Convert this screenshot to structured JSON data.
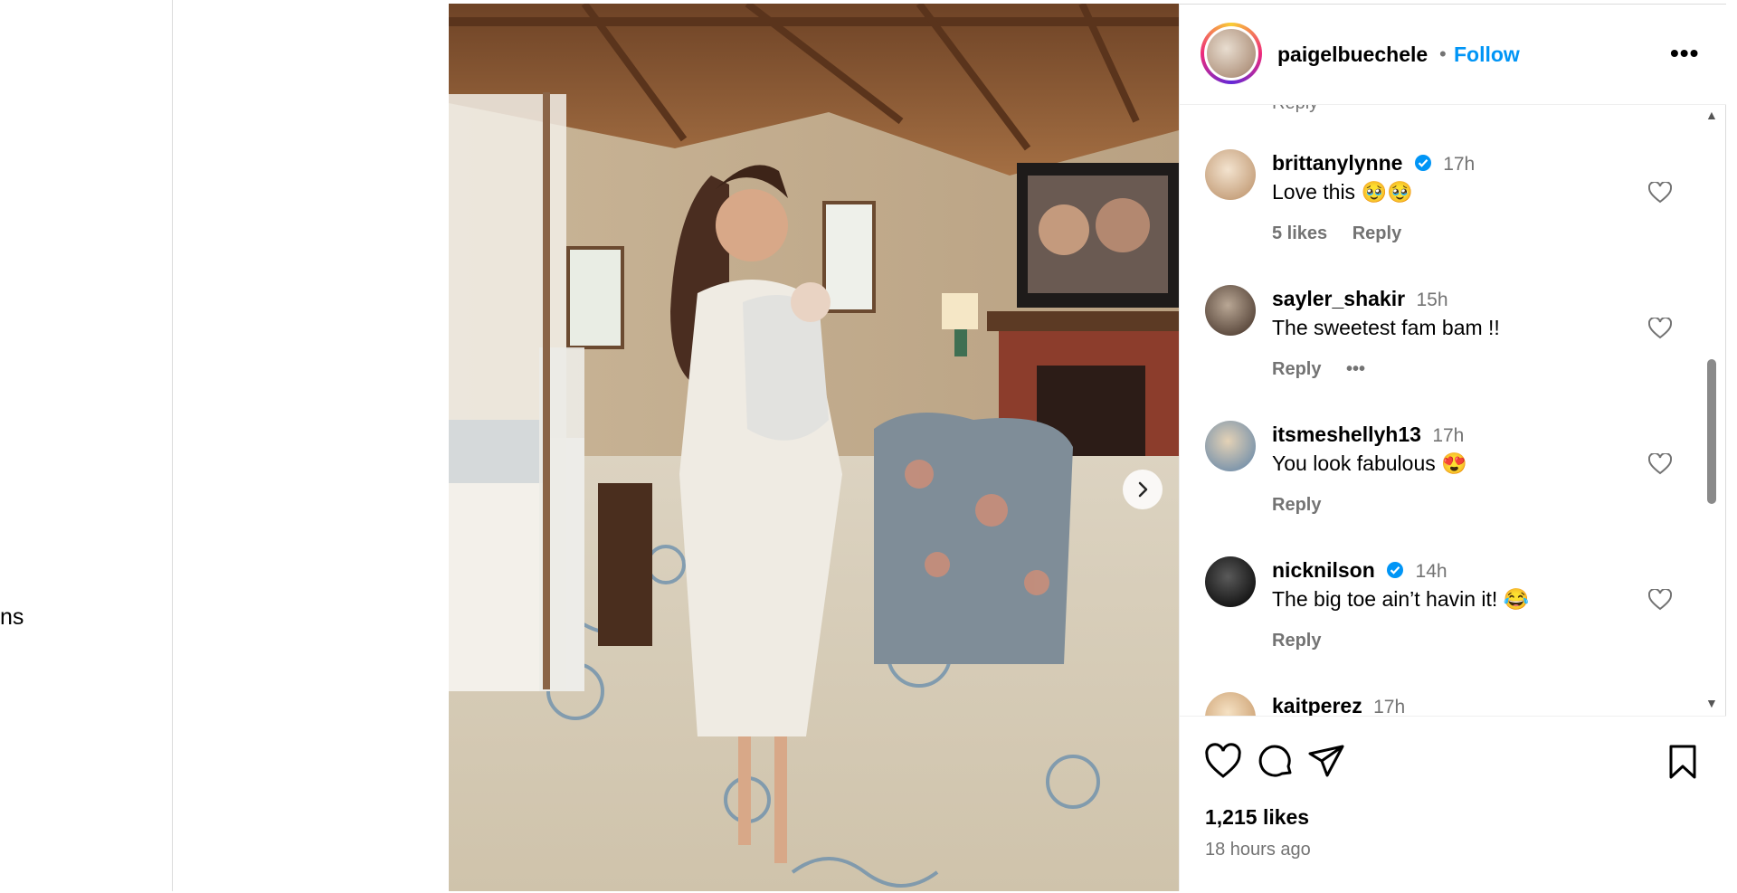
{
  "sidebar": {
    "fragment_text": "ns"
  },
  "post": {
    "author": "paigelbuechele",
    "follow_label": "Follow",
    "separator": "•",
    "more_label": "•••",
    "partial_reply": "Reply",
    "comments": [
      {
        "user": "brittanylynne",
        "verified": true,
        "time": "17h",
        "text": "Love this 🥹🥹",
        "likes": "5 likes",
        "reply": "Reply",
        "more": "",
        "avatar_color": "#d9c2a6"
      },
      {
        "user": "sayler_shakir",
        "verified": false,
        "time": "15h",
        "text": "The sweetest fam bam !!",
        "likes": "",
        "reply": "Reply",
        "more": "•••",
        "avatar_color": "#7a6a5c"
      },
      {
        "user": "itsmeshellyh13",
        "verified": false,
        "time": "17h",
        "text": "You look fabulous 😍",
        "likes": "",
        "reply": "Reply",
        "more": "",
        "avatar_color": "#9fb3c7"
      },
      {
        "user": "nicknilson",
        "verified": true,
        "time": "14h",
        "text": "The big toe ain’t havin it! 😂",
        "likes": "",
        "reply": "Reply",
        "more": "",
        "avatar_color": "#2a2a2a"
      },
      {
        "user": "kaitperez",
        "verified": false,
        "time": "17h",
        "text": "",
        "likes": "",
        "reply": "",
        "more": "",
        "avatar_color": "#e6c9a2"
      }
    ],
    "likes_count": "1,215 likes",
    "time_ago": "18 hours ago",
    "icons": [
      "heart-icon",
      "comment-icon",
      "share-icon",
      "bookmark-icon",
      "chevron-right-icon",
      "verified-icon"
    ],
    "colors": {
      "follow": "#0095f6",
      "verified": "#0095f6",
      "muted": "#737373"
    }
  }
}
